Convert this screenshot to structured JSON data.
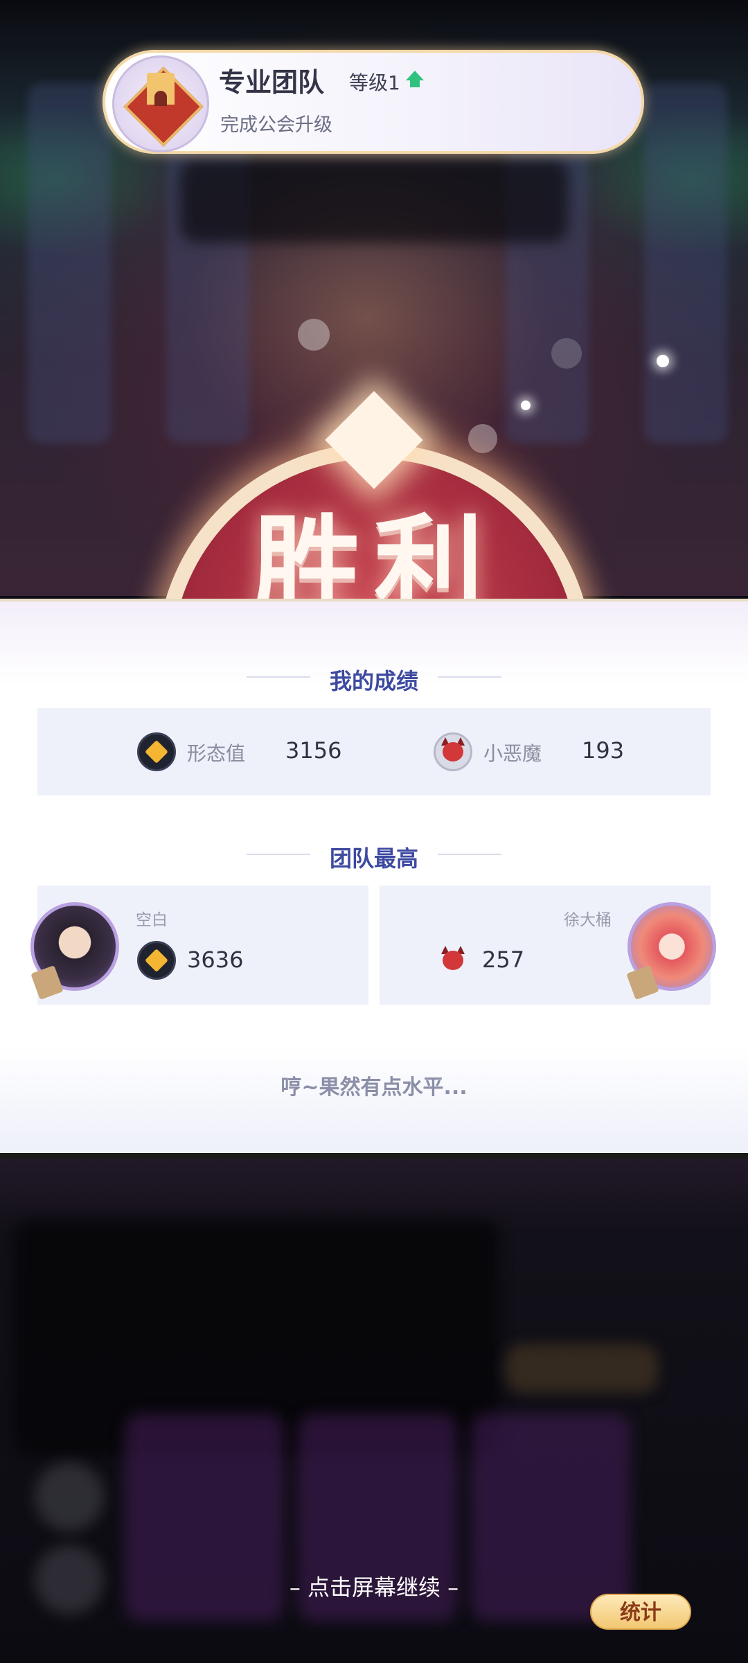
{
  "banner": {
    "title": "专业团队",
    "level_text": "等级1",
    "subtitle": "完成公会升级",
    "icons": [
      "guild-castle-icon",
      "level-up-arrow-icon"
    ]
  },
  "victory": {
    "text": "胜利"
  },
  "my_score": {
    "heading": "我的成绩",
    "stats": [
      {
        "icon": "shape-value-coin-icon",
        "label": "形态值",
        "value": "3156"
      },
      {
        "icon": "little-devil-icon",
        "label": "小恶魔",
        "value": "193"
      }
    ]
  },
  "team_best": {
    "heading": "团队最高",
    "entries": [
      {
        "player": "空白",
        "icon": "shape-value-coin-icon",
        "value": "3636"
      },
      {
        "player": "徐大桶",
        "icon": "little-devil-icon",
        "value": "257"
      }
    ]
  },
  "taunt": "哼~果然有点水平...",
  "continue_hint": "– 点击屏幕继续 –",
  "stats_button_label": "统计",
  "colors": {
    "section_title": "#3d4aa0",
    "level_up": "#2ec27e",
    "victory_red": "#a32b3d",
    "stats_button": "#f2c873"
  }
}
